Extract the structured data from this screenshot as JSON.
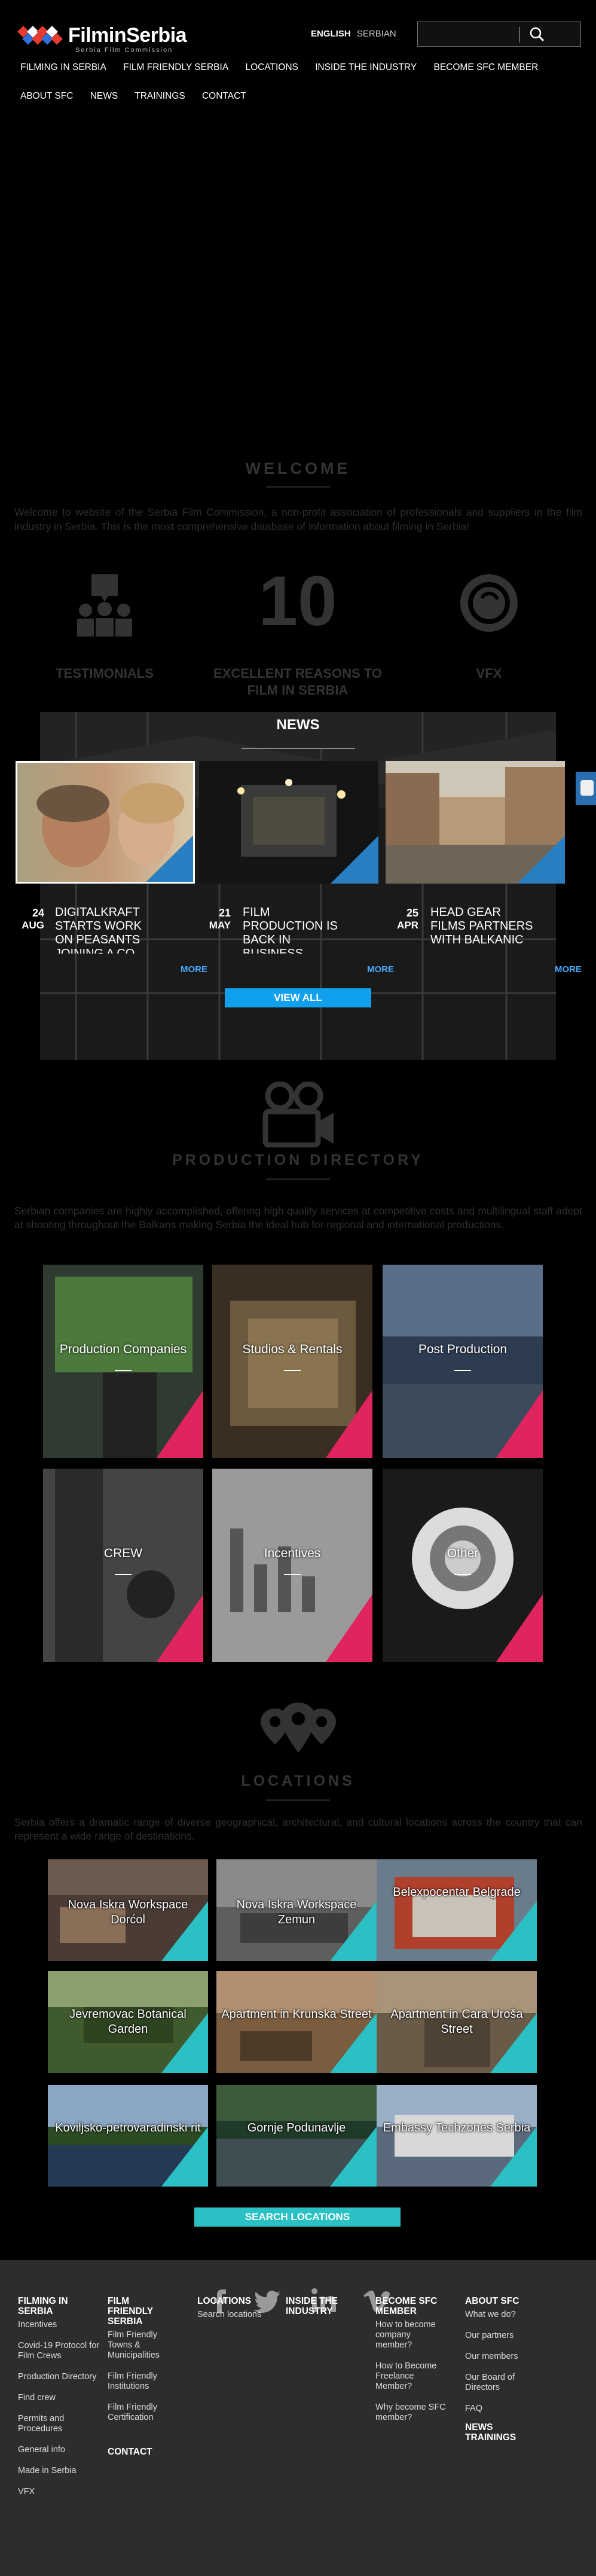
{
  "header": {
    "logo_name": "FilminSerbia",
    "logo_sub": "Serbia Film Commission",
    "lang_active": "ENGLISH",
    "lang_other": "SERBIAN",
    "search_placeholder": "",
    "nav_row1": [
      "FILMING IN SERBIA",
      "FILM FRIENDLY SERBIA",
      "LOCATIONS",
      "INSIDE THE INDUSTRY",
      "BECOME SFC MEMBER"
    ],
    "nav_row2": [
      "ABOUT SFC",
      "NEWS",
      "TRAININGS",
      "CONTACT"
    ]
  },
  "welcome": {
    "title": "WELCOME",
    "text": "Welcome to website of the Serbia Film Commission, a non-profit association of professionals and suppliers in the film industry in Serbia. This is the most comprehensive database of information about filming in Serbia!",
    "features": [
      {
        "label": "TESTIMONIALS",
        "icon": "testimonials-icon"
      },
      {
        "number": "10",
        "label": "EXCELLENT REASONS TO FILM IN SERBIA"
      },
      {
        "label": "VFX",
        "icon": "vfx-icon"
      }
    ]
  },
  "news": {
    "title": "NEWS",
    "items": [
      {
        "day": "24",
        "month": "AUG",
        "headline": "DIGITALKRAFT STARTS WORK ON PEASANTS JOINING A CO"
      },
      {
        "day": "21",
        "month": "MAY",
        "headline": "FILM PRODUCTION IS BACK IN BUSINESS"
      },
      {
        "day": "25",
        "month": "APR",
        "headline": "HEAD GEAR FILMS PARTNERS WITH BALKANIC"
      }
    ],
    "more_label": "MORE",
    "view_all": "VIEW ALL"
  },
  "production": {
    "title": "PRODUCTION DIRECTORY",
    "text": "Serbian companies are highly accomplished, offering high quality services at competitive costs and multilingual staff adept at shooting throughout the Balkans making Serbia the ideal hub for regional and international productions.",
    "tiles": [
      "Production Companies",
      "Studios & Rentals",
      "Post Production",
      "CREW",
      "Incentives",
      "Other"
    ]
  },
  "locations": {
    "title": "LOCATIONS",
    "text": "Serbia offers a dramatic range of diverse geographical, architectural, and cultural locations across the country that can represent a wide range of destinations.",
    "items": [
      "Nova Iskra Workspace Dorćol",
      "Nova Iskra Workspace Zemun",
      "Belexpocentar Belgrade",
      "Jevremovac Botanical Garden",
      "Apartment in Krunska Street",
      "Apartment in Cara Uroša Street",
      "Koviljsko-petrovaradinski rit",
      "Gornje Podunavlje",
      "Embassy Techzones Serbia"
    ],
    "search_label": "SEARCH LOCATIONS"
  },
  "footer": {
    "social": [
      "facebook-icon",
      "twitter-icon",
      "linkedin-icon",
      "vimeo-icon"
    ],
    "col1": {
      "heading": "FILMING IN SERBIA",
      "items": [
        "Incentives",
        "Covid-19 Protocol for Film Crews",
        "Production Directory",
        "Find crew",
        "Permits and Procedures",
        "General info",
        "Made in Serbia",
        "VFX"
      ]
    },
    "col2": {
      "heading": "FILM FRIENDLY SERBIA",
      "items": [
        "Film Friendly Towns & Municipalities",
        "Film Friendly Institutions",
        "Film Friendly Certification"
      ],
      "contact": "CONTACT"
    },
    "col3": {
      "heading": "LOCATIONS",
      "items": [
        "Search locations"
      ]
    },
    "col4": {
      "heading": "INSIDE THE INDUSTRY",
      "items": []
    },
    "col5": {
      "heading": "BECOME SFC MEMBER",
      "items": [
        "How to become company member?",
        "How to Become Freelance Member?",
        "Why become SFC member?"
      ]
    },
    "col6": {
      "heading": "ABOUT SFC",
      "items": [
        "What we do?",
        "Our partners",
        "Our members",
        "Our Board of Directors",
        "FAQ"
      ],
      "news": "NEWS",
      "trainings": "TRAININGS"
    }
  }
}
